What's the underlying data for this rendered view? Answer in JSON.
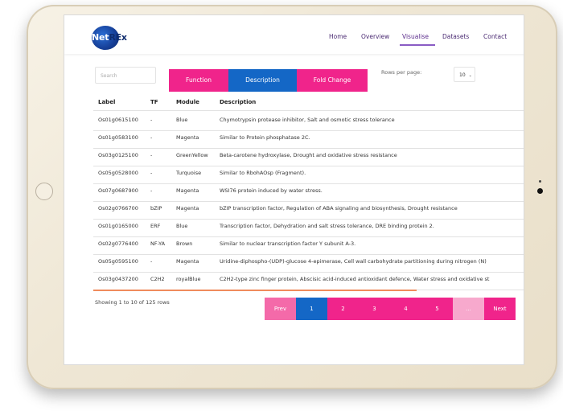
{
  "brand": {
    "logo_main": "Net",
    "logo_accent": "REx"
  },
  "nav": {
    "items": [
      {
        "label": "Home"
      },
      {
        "label": "Overview"
      },
      {
        "label": "Visualise"
      },
      {
        "label": "Datasets"
      },
      {
        "label": "Contact"
      }
    ],
    "active": "Visualise"
  },
  "controls": {
    "search_placeholder": "Search",
    "segments": [
      {
        "label": "Function"
      },
      {
        "label": "Description"
      },
      {
        "label": "Fold Change"
      }
    ],
    "selected_segment": "Description",
    "rows_per_page_label": "Rows per page:",
    "rows_per_page_value": "10",
    "rows_per_page_caret": "⌄"
  },
  "table": {
    "columns": [
      "Label",
      "TF",
      "Module",
      "Description"
    ],
    "rows": [
      [
        "Os01g0615100",
        "-",
        "Blue",
        "Chymotrypsin protease inhibitor, Salt and osmotic stress tolerance"
      ],
      [
        "Os01g0583100",
        "-",
        "Magenta",
        "Similar to Protein phosphatase 2C."
      ],
      [
        "Os03g0125100",
        "-",
        "GreenYellow",
        "Beta-carotene hydroxylase, Drought and oxidative stress resistance"
      ],
      [
        "Os05g0528000",
        "-",
        "Turquoise",
        "Similar to RbohAOsp (Fragment)."
      ],
      [
        "Os07g0687900",
        "-",
        "Magenta",
        "WSI76 protein induced by water stress."
      ],
      [
        "Os02g0766700",
        "bZIP",
        "Magenta",
        "bZIP transcription factor, Regulation of ABA signaling and biosynthesis, Drought resistance"
      ],
      [
        "Os01g0165000",
        "ERF",
        "Blue",
        "Transcription factor, Dehydration and salt stress tolerance, DRE binding protein 2."
      ],
      [
        "Os02g0776400",
        "NF-YA",
        "Brown",
        "Similar to nuclear transcription factor Y subunit A-3."
      ],
      [
        "Os05g0595100",
        "-",
        "Magenta",
        "Uridine-diphospho-(UDP)-glucose 4-epimerase, Cell wall carbohydrate partitioning during nitrogen (N)"
      ],
      [
        "Os03g0437200",
        "C2H2",
        "royalBlue",
        "C2H2-type zinc finger protein, Abscisic acid-induced antioxidant defence, Water stress and oxidative st"
      ]
    ]
  },
  "summary": {
    "showing_text": "Showing 1 to 10 of 125 rows"
  },
  "pagination": {
    "prev_label": "Prev",
    "pages": [
      "1",
      "2",
      "3",
      "4",
      "5"
    ],
    "active_page": "1",
    "ellipsis": "...",
    "next_label": "Next"
  },
  "colors": {
    "accent_pink": "#f0248b",
    "accent_blue": "#1467c6",
    "nav_text": "#4a2a72",
    "progress": "#f08b5c"
  }
}
